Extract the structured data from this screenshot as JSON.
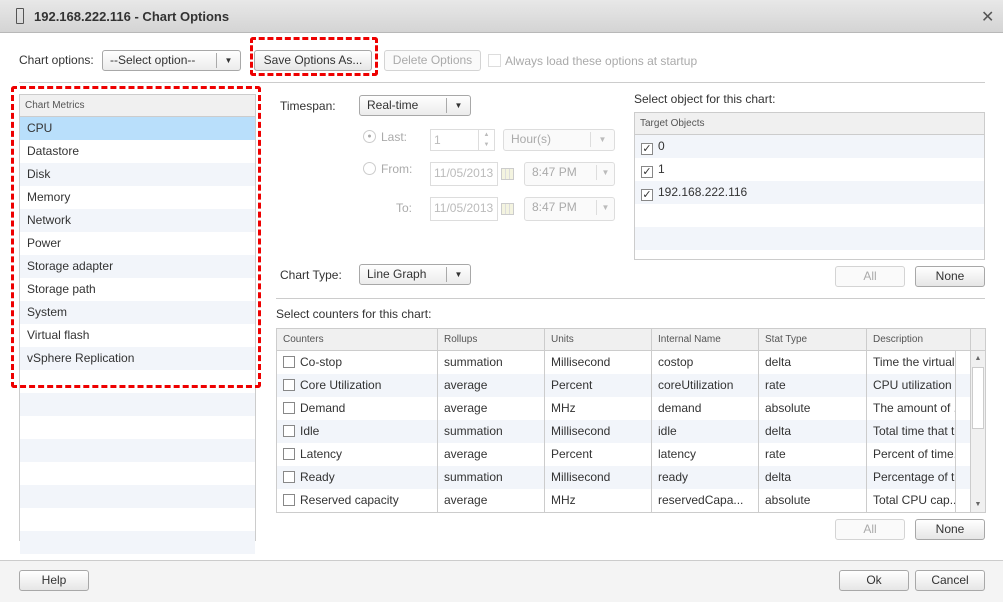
{
  "window": {
    "title": "192.168.222.116 - Chart Options"
  },
  "toolbar": {
    "chart_options_label": "Chart options:",
    "select_value": "--Select option--",
    "save_as": "Save Options As...",
    "delete": "Delete Options",
    "always_load": "Always load these options at startup"
  },
  "metrics": {
    "header": "Chart Metrics",
    "items": [
      "CPU",
      "Datastore",
      "Disk",
      "Memory",
      "Network",
      "Power",
      "Storage adapter",
      "Storage path",
      "System",
      "Virtual flash",
      "vSphere Replication"
    ],
    "selected": "CPU"
  },
  "timespan": {
    "label": "Timespan:",
    "value": "Real-time",
    "last_label": "Last:",
    "last_value": "1",
    "last_unit": "Hour(s)",
    "from_label": "From:",
    "from_date": "11/05/2013",
    "from_time": "8:47 PM",
    "to_label": "To:",
    "to_date": "11/05/2013",
    "to_time": "8:47 PM"
  },
  "chart_type": {
    "label": "Chart Type:",
    "value": "Line Graph"
  },
  "objects": {
    "label": "Select object for this chart:",
    "header": "Target Objects",
    "items": [
      {
        "name": "0",
        "checked": true
      },
      {
        "name": "1",
        "checked": true
      },
      {
        "name": "192.168.222.116",
        "checked": true
      }
    ],
    "all": "All",
    "none": "None"
  },
  "counters": {
    "label": "Select counters for this chart:",
    "columns": [
      "Counters",
      "Rollups",
      "Units",
      "Internal Name",
      "Stat Type",
      "Description"
    ],
    "rows": [
      [
        "Co-stop",
        "summation",
        "Millisecond",
        "costop",
        "delta",
        "Time the virtual..."
      ],
      [
        "Core Utilization",
        "average",
        "Percent",
        "coreUtilization",
        "rate",
        "CPU utilization ..."
      ],
      [
        "Demand",
        "average",
        "MHz",
        "demand",
        "absolute",
        "The amount of ..."
      ],
      [
        "Idle",
        "summation",
        "Millisecond",
        "idle",
        "delta",
        "Total time that t..."
      ],
      [
        "Latency",
        "average",
        "Percent",
        "latency",
        "rate",
        "Percent of time..."
      ],
      [
        "Ready",
        "summation",
        "Millisecond",
        "ready",
        "delta",
        "Percentage of t..."
      ],
      [
        "Reserved capacity",
        "average",
        "MHz",
        "reservedCapa...",
        "absolute",
        "Total CPU cap..."
      ]
    ],
    "all": "All",
    "none": "None"
  },
  "footer": {
    "help": "Help",
    "ok": "Ok",
    "cancel": "Cancel"
  }
}
